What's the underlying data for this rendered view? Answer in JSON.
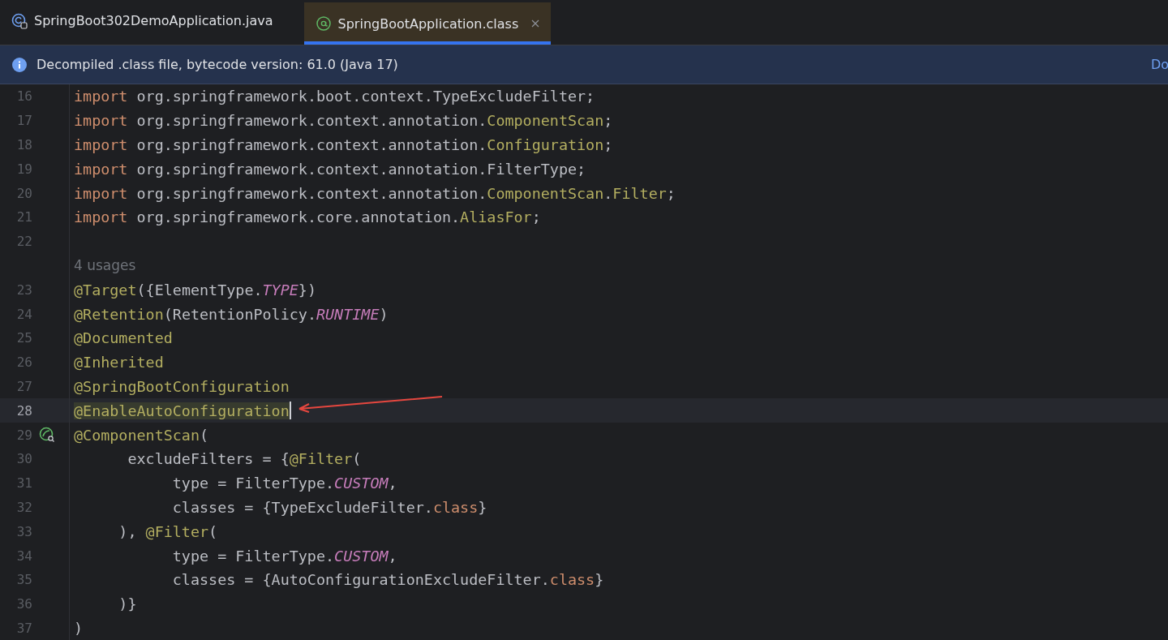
{
  "tabs": [
    {
      "label": "SpringBoot302DemoApplication.java",
      "kind": "class",
      "selected": false,
      "closable": false
    },
    {
      "label": "SpringBootApplication.class",
      "kind": "annotation",
      "selected": true,
      "closable": true
    }
  ],
  "banner": {
    "message": "Decompiled .class file, bytecode version: 61.0 (Java 17)",
    "link": "Do"
  },
  "lines": [
    {
      "number": "16",
      "current": false,
      "gutter_icon": false,
      "caret": false,
      "tokens": [
        {
          "text": "import",
          "kind": "kw"
        },
        {
          "text": " org.springframework.boot.context.TypeExcludeFilter;",
          "kind": "plain"
        }
      ]
    },
    {
      "number": "17",
      "current": false,
      "gutter_icon": false,
      "caret": false,
      "tokens": [
        {
          "text": "import",
          "kind": "kw"
        },
        {
          "text": " org.springframework.context.annotation.",
          "kind": "plain"
        },
        {
          "text": "ComponentScan",
          "kind": "ann"
        },
        {
          "text": ";",
          "kind": "plain"
        }
      ]
    },
    {
      "number": "18",
      "current": false,
      "gutter_icon": false,
      "caret": false,
      "tokens": [
        {
          "text": "import",
          "kind": "kw"
        },
        {
          "text": " org.springframework.context.annotation.",
          "kind": "plain"
        },
        {
          "text": "Configuration",
          "kind": "ann"
        },
        {
          "text": ";",
          "kind": "plain"
        }
      ]
    },
    {
      "number": "19",
      "current": false,
      "gutter_icon": false,
      "caret": false,
      "tokens": [
        {
          "text": "import",
          "kind": "kw"
        },
        {
          "text": " org.springframework.context.annotation.FilterType;",
          "kind": "plain"
        }
      ]
    },
    {
      "number": "20",
      "current": false,
      "gutter_icon": false,
      "caret": false,
      "tokens": [
        {
          "text": "import",
          "kind": "kw"
        },
        {
          "text": " org.springframework.context.annotation.",
          "kind": "plain"
        },
        {
          "text": "ComponentScan",
          "kind": "ann"
        },
        {
          "text": ".",
          "kind": "plain"
        },
        {
          "text": "Filter",
          "kind": "ann"
        },
        {
          "text": ";",
          "kind": "plain"
        }
      ]
    },
    {
      "number": "21",
      "current": false,
      "gutter_icon": false,
      "caret": false,
      "tokens": [
        {
          "text": "import",
          "kind": "kw"
        },
        {
          "text": " org.springframework.core.annotation.",
          "kind": "plain"
        },
        {
          "text": "AliasFor",
          "kind": "ann"
        },
        {
          "text": ";",
          "kind": "plain"
        }
      ]
    },
    {
      "number": "22",
      "current": false,
      "gutter_icon": false,
      "caret": false
    },
    {
      "current": false,
      "gutter_icon": false,
      "caret": false,
      "tokens": [
        {
          "text": "4 usages",
          "kind": "hint"
        }
      ]
    },
    {
      "number": "23",
      "current": false,
      "gutter_icon": false,
      "caret": false,
      "tokens": [
        {
          "text": "@Target",
          "kind": "ann"
        },
        {
          "text": "({ElementType.",
          "kind": "plain"
        },
        {
          "text": "TYPE",
          "kind": "const"
        },
        {
          "text": "})",
          "kind": "plain"
        }
      ]
    },
    {
      "number": "24",
      "current": false,
      "gutter_icon": false,
      "caret": false,
      "tokens": [
        {
          "text": "@Retention",
          "kind": "ann"
        },
        {
          "text": "(RetentionPolicy.",
          "kind": "plain"
        },
        {
          "text": "RUNTIME",
          "kind": "const"
        },
        {
          "text": ")",
          "kind": "plain"
        }
      ]
    },
    {
      "number": "25",
      "current": false,
      "gutter_icon": false,
      "caret": false,
      "tokens": [
        {
          "text": "@Documented",
          "kind": "ann"
        }
      ]
    },
    {
      "number": "26",
      "current": false,
      "gutter_icon": false,
      "caret": false,
      "tokens": [
        {
          "text": "@Inherited",
          "kind": "ann"
        }
      ]
    },
    {
      "number": "27",
      "current": false,
      "gutter_icon": false,
      "caret": false,
      "tokens": [
        {
          "text": "@SpringBootConfiguration",
          "kind": "ann"
        }
      ]
    },
    {
      "number": "28",
      "current": true,
      "gutter_icon": false,
      "caret": true,
      "tokens": [
        {
          "text": "@EnableAutoConfiguration",
          "kind": "ann-hl"
        }
      ]
    },
    {
      "number": "29",
      "current": false,
      "gutter_icon": true,
      "caret": false,
      "tokens": [
        {
          "text": "@ComponentScan",
          "kind": "ann"
        },
        {
          "text": "(",
          "kind": "plain"
        }
      ]
    },
    {
      "number": "30",
      "current": false,
      "gutter_icon": false,
      "caret": false,
      "tokens": [
        {
          "text": "      excludeFilters = {",
          "kind": "plain"
        },
        {
          "text": "@Filter",
          "kind": "ann"
        },
        {
          "text": "(",
          "kind": "plain"
        }
      ]
    },
    {
      "number": "31",
      "current": false,
      "gutter_icon": false,
      "caret": false,
      "tokens": [
        {
          "text": "           type = FilterType.",
          "kind": "plain"
        },
        {
          "text": "CUSTOM",
          "kind": "const"
        },
        {
          "text": ",",
          "kind": "plain"
        }
      ]
    },
    {
      "number": "32",
      "current": false,
      "gutter_icon": false,
      "caret": false,
      "tokens": [
        {
          "text": "           classes = {TypeExcludeFilter.",
          "kind": "plain"
        },
        {
          "text": "class",
          "kind": "kw"
        },
        {
          "text": "}",
          "kind": "plain"
        }
      ]
    },
    {
      "number": "33",
      "current": false,
      "gutter_icon": false,
      "caret": false,
      "tokens": [
        {
          "text": "     ), ",
          "kind": "plain"
        },
        {
          "text": "@Filter",
          "kind": "ann"
        },
        {
          "text": "(",
          "kind": "plain"
        }
      ]
    },
    {
      "number": "34",
      "current": false,
      "gutter_icon": false,
      "caret": false,
      "tokens": [
        {
          "text": "           type = FilterType.",
          "kind": "plain"
        },
        {
          "text": "CUSTOM",
          "kind": "const"
        },
        {
          "text": ",",
          "kind": "plain"
        }
      ]
    },
    {
      "number": "35",
      "current": false,
      "gutter_icon": false,
      "caret": false,
      "tokens": [
        {
          "text": "           classes = {AutoConfigurationExcludeFilter.",
          "kind": "plain"
        },
        {
          "text": "class",
          "kind": "kw"
        },
        {
          "text": "}",
          "kind": "plain"
        }
      ]
    },
    {
      "number": "36",
      "current": false,
      "gutter_icon": false,
      "caret": false,
      "tokens": [
        {
          "text": "     )}",
          "kind": "plain"
        }
      ]
    },
    {
      "number": "37",
      "current": false,
      "gutter_icon": false,
      "caret": false,
      "tokens": [
        {
          "text": ")",
          "kind": "plain"
        }
      ]
    }
  ]
}
